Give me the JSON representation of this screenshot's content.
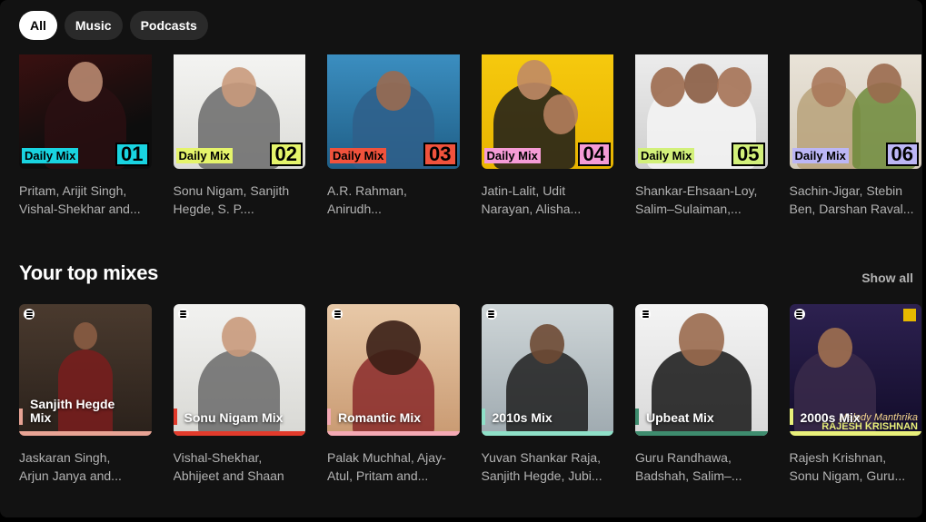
{
  "filters": [
    {
      "label": "All",
      "active": true
    },
    {
      "label": "Music",
      "active": false
    },
    {
      "label": "Podcasts",
      "active": false
    }
  ],
  "daily_mixes": [
    {
      "label": "Daily Mix",
      "number": "01",
      "accent": "#19d3e0",
      "line1": "Pritam, Arijit Singh,",
      "line2": "Vishal-Shekhar and..."
    },
    {
      "label": "Daily Mix",
      "number": "02",
      "accent": "#e5f46b",
      "line1": "Sonu Nigam, Sanjith",
      "line2": "Hegde, S. P...."
    },
    {
      "label": "Daily Mix",
      "number": "03",
      "accent": "#f0523c",
      "line1": "A.R. Rahman,",
      "line2": "Anirudh..."
    },
    {
      "label": "Daily Mix",
      "number": "04",
      "accent": "#f59bd6",
      "line1": "Jatin-Lalit, Udit",
      "line2": "Narayan, Alisha..."
    },
    {
      "label": "Daily Mix",
      "number": "05",
      "accent": "#d2f07a",
      "line1": "Shankar-Ehsaan-Loy,",
      "line2": "Salim–Sulaiman,..."
    },
    {
      "label": "Daily Mix",
      "number": "06",
      "accent": "#bcb6f5",
      "line1": "Sachin-Jigar, Stebin",
      "line2": "Ben, Darshan Raval..."
    }
  ],
  "top_mixes_section": {
    "title": "Your top mixes",
    "show_all": "Show all"
  },
  "top_mixes": [
    {
      "title": "Sanjith Hegde Mix",
      "accent": "#e8a394",
      "line1": "Jaskaran Singh,",
      "line2": "Arjun Janya and..."
    },
    {
      "title": "Sonu Nigam Mix",
      "accent": "#e23b2c",
      "line1": "Vishal-Shekhar,",
      "line2": "Abhijeet and Shaan"
    },
    {
      "title": "Romantic Mix",
      "accent": "#f4a9b4",
      "line1": "Palak Muchhal, Ajay-",
      "line2": "Atul, Pritam and..."
    },
    {
      "title": "2010s Mix",
      "accent": "#8fe0c8",
      "line1": "Yuvan Shankar Raja,",
      "line2": "Sanjith Hegde, Jubi..."
    },
    {
      "title": "Upbeat Mix",
      "accent": "#3e8c6e",
      "line1": "Guru Randhawa,",
      "line2": "Badshah, Salim–..."
    },
    {
      "title": "2000s Mix",
      "accent": "#e9f07a",
      "line1": "Rajesh Krishnan,",
      "line2": "Sonu Nigam, Guru..."
    }
  ],
  "overlay": {
    "caption": "Melody Manthrika",
    "name": "RAJESH KRISHNAN"
  }
}
